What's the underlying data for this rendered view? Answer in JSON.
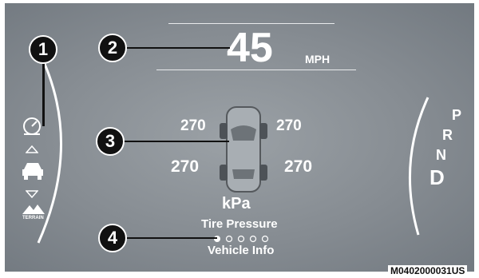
{
  "speed": {
    "value": "45",
    "unit": "MPH"
  },
  "tires": {
    "front_left": "270",
    "front_right": "270",
    "rear_left": "270",
    "rear_right": "270",
    "unit": "kPa"
  },
  "menu": {
    "title": "Tire Pressure",
    "subtitle": "Vehicle Info",
    "page_index": 1,
    "page_count": 5
  },
  "gear": {
    "p": "P",
    "r": "R",
    "n": "N",
    "d": "D"
  },
  "left_icons": {
    "terrain_label": "TERRAIN"
  },
  "callouts": {
    "c1": "1",
    "c2": "2",
    "c3": "3",
    "c4": "4"
  },
  "figure_code": "M0402000031US",
  "colors": {
    "screen": "#868c92",
    "text": "#ffffff",
    "callout": "#111111"
  }
}
